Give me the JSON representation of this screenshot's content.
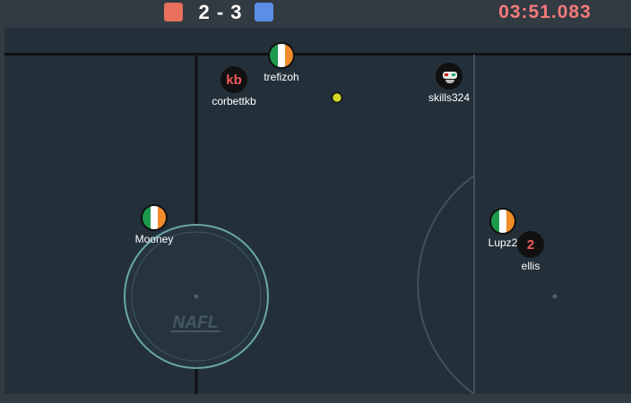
{
  "scoreboard": {
    "red_team_color": "#e8705c",
    "blue_team_color": "#5b8ee6",
    "score": "2 - 3",
    "timer": "03:51.083"
  },
  "field": {
    "background": "#23303a",
    "line_color": "#0d1014",
    "circle_color": "#6aa8a8",
    "watermark": "NAFL"
  },
  "ball": {
    "color": "#d2d625"
  },
  "players": {
    "trefizoh": {
      "name": "trefizoh",
      "avatar": "ireland-flag"
    },
    "corbettkb": {
      "name": "corbettkb",
      "avatar_text": "kb"
    },
    "skills324": {
      "name": "skills324",
      "avatar": "mask-icon"
    },
    "mooney": {
      "name": "Mooney",
      "avatar": "ireland-flag"
    },
    "lupz": {
      "name": "Lupz2",
      "avatar": "ireland-flag"
    },
    "ellis": {
      "name": "ellis",
      "avatar_text": "2"
    }
  }
}
